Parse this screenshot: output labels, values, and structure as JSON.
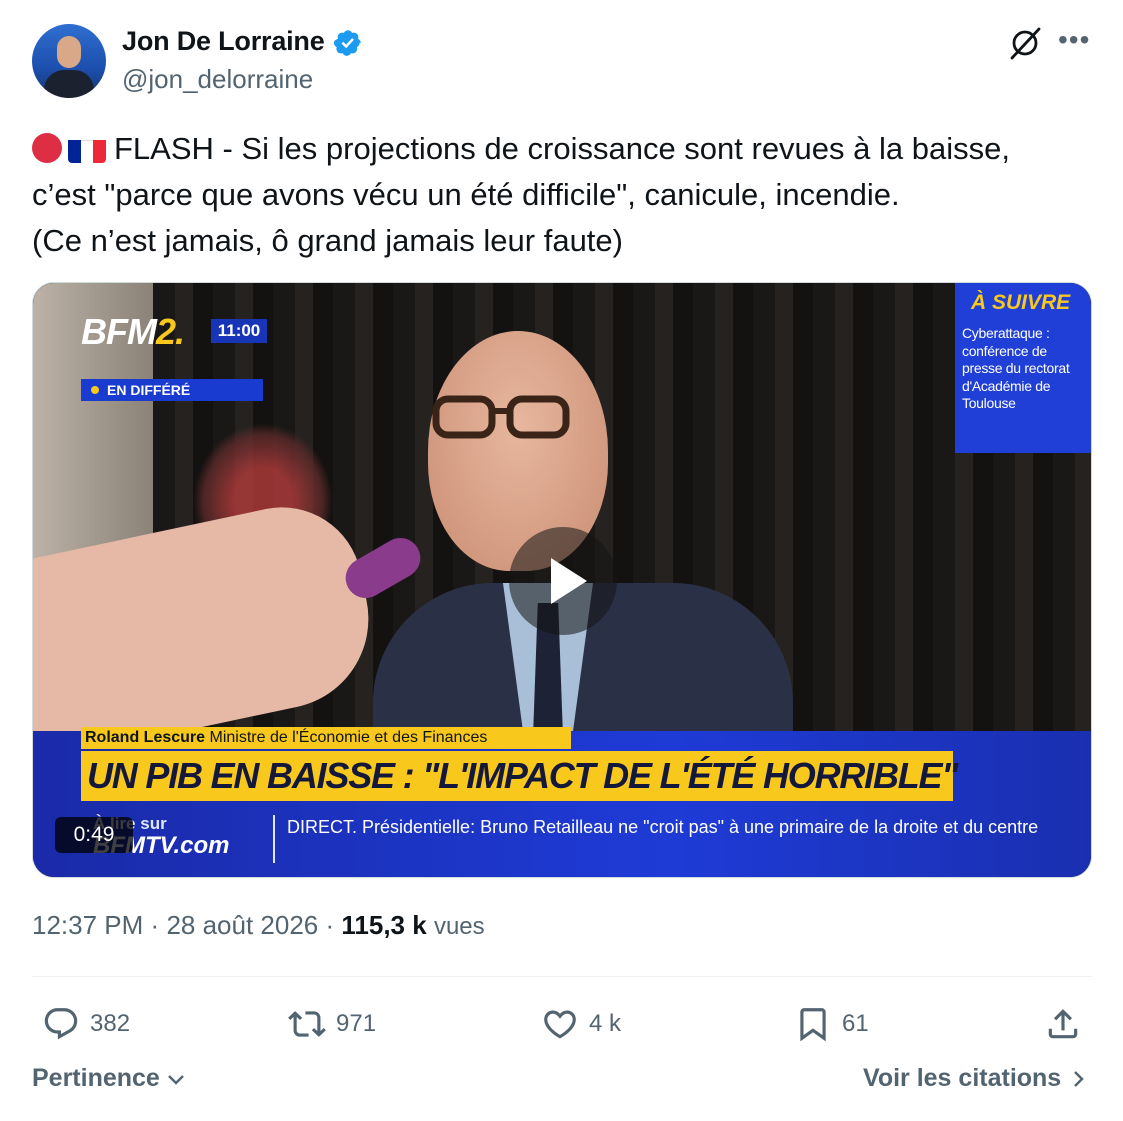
{
  "author": {
    "name": "Jon De Lorraine",
    "handle": "@jon_delorraine"
  },
  "tweet": {
    "lines": [
      "FLASH - Si les projections de croissance sont revues à la baisse,",
      "c’est \"parce que avons vécu un été difficile\", canicule, incendie.",
      "(Ce n’est jamais, ô grand jamais leur faute)"
    ]
  },
  "video": {
    "channel_logo_main": "BFM",
    "channel_logo_accent": "2.",
    "clock": "11:00",
    "live_status": "EN DIFFÉRÉ",
    "up_next_title": "À SUIVRE",
    "up_next_text": "Cyberattaque : conférence de presse du rectorat d'Académie de Toulouse",
    "speaker_name": "Roland Lescure",
    "speaker_role": "Ministre de l'Économie et des Finances",
    "headline": "UN PIB EN BAISSE : \"L'IMPACT DE L'ÉTÉ HORRIBLE\"",
    "site_prefix": "À lire sur",
    "site_name": "BFMTV.com",
    "ticker": "DIRECT. Présidentielle: Bruno Retailleau ne \"croit pas\" à une primaire de la droite et du centre",
    "duration": "0:49"
  },
  "meta": {
    "time": "12:37 PM",
    "sep": "·",
    "date": "28 août 2026",
    "views_count": "115,3 k",
    "views_label": "vues"
  },
  "actions": {
    "replies": "382",
    "reposts": "971",
    "likes": "4 k",
    "bookmarks": "61"
  },
  "footer": {
    "sort_label": "Pertinence",
    "quotes_label": "Voir les citations"
  },
  "colors": {
    "text": "#0f1419",
    "secondary": "#536471",
    "verified": "#1d9bf0",
    "bfm_yellow": "#f8c81c",
    "bfm_blue": "#1f3fd6"
  }
}
